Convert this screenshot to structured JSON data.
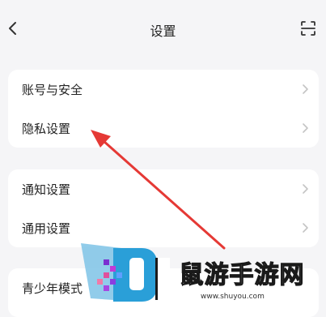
{
  "header": {
    "title": "设置",
    "back_icon": "chevron-left-icon",
    "scan_icon": "scan-icon"
  },
  "groups": [
    {
      "items": [
        {
          "label": "账号与安全"
        },
        {
          "label": "隐私设置"
        }
      ]
    },
    {
      "items": [
        {
          "label": "通知设置"
        },
        {
          "label": "通用设置"
        }
      ]
    },
    {
      "items": [
        {
          "label": "青少年模式"
        }
      ]
    }
  ],
  "annotation": {
    "color": "#e53935",
    "type": "arrow"
  },
  "watermark": {
    "text": "鼠游手游网",
    "url": "www.shuyou.com"
  }
}
